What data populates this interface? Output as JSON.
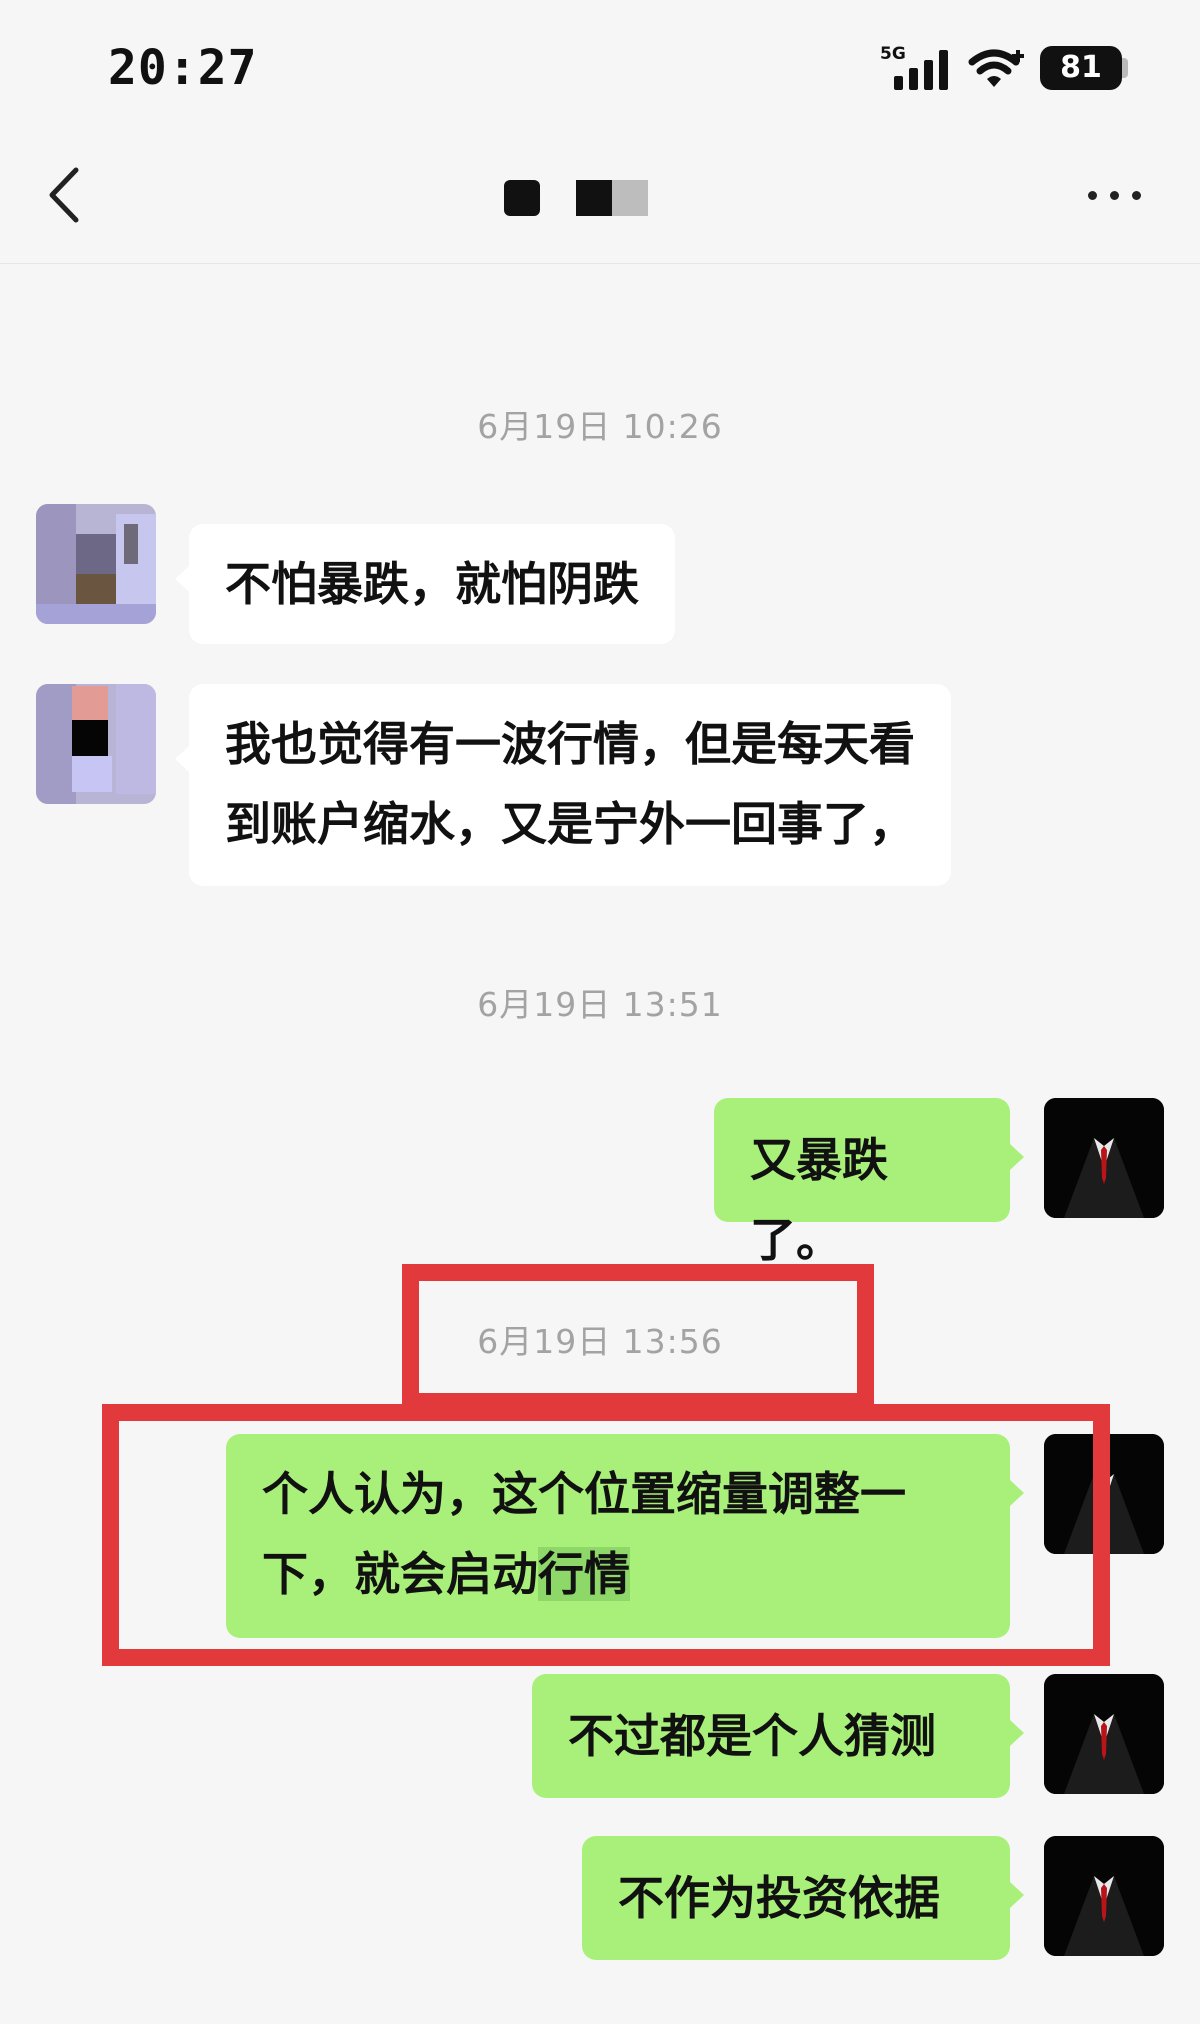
{
  "status_bar": {
    "time": "20:27",
    "network": "5G",
    "battery": "81"
  },
  "header": {
    "title": ""
  },
  "messages": [
    {
      "type": "timestamp",
      "text": "6月19日 10:26"
    },
    {
      "type": "incoming",
      "text": "不怕暴跌，就怕阴跌"
    },
    {
      "type": "incoming",
      "lines": [
        "我也觉得有一波行情，但是每天看",
        "到账户缩水，又是宁外一回事了，"
      ]
    },
    {
      "type": "timestamp",
      "text": "6月19日 13:51"
    },
    {
      "type": "outgoing",
      "text": "又暴跌了。"
    },
    {
      "type": "timestamp",
      "text": "6月19日 13:56"
    },
    {
      "type": "outgoing",
      "lines": [
        "个人认为，这个位置缩量调整一",
        "下，就会启动"
      ],
      "highlighted": "行情"
    },
    {
      "type": "outgoing",
      "text": "不过都是个人猜测"
    },
    {
      "type": "outgoing",
      "text": "不作为投资依据"
    }
  ],
  "colors": {
    "outgoing_bubble": "#a9f07a",
    "incoming_bubble": "#ffffff",
    "annotation_red": "#e2393c",
    "background": "#f6f6f6"
  },
  "icons": [
    "back-arrow-icon",
    "more-icon",
    "signal-icon",
    "wifi-icon",
    "battery-icon"
  ]
}
